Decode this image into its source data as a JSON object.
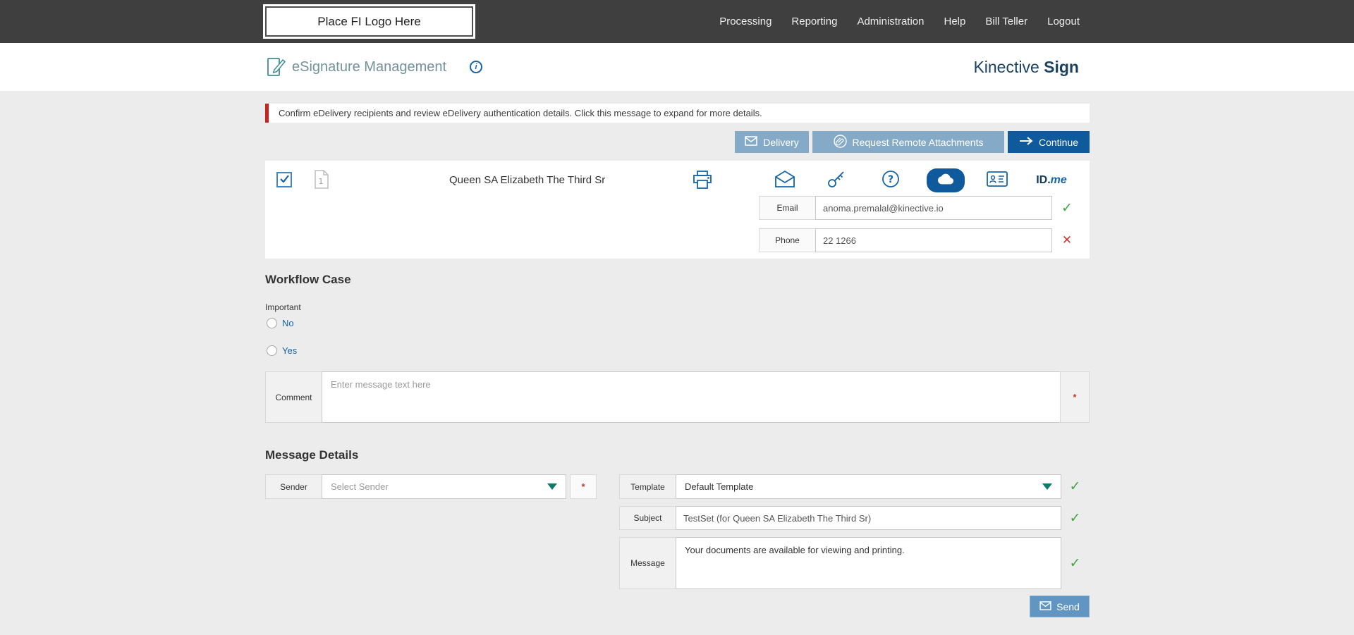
{
  "colors": {
    "accent_blue": "#1565a8",
    "dark_blue": "#0e5a9c",
    "steel_blue": "#84aac8",
    "send_blue": "#6096c1",
    "navy_brand": "#1b4263",
    "teal_caret": "#0b7c6c",
    "success_green": "#41a443",
    "error_red": "#c63232",
    "alert_red": "#c7231f",
    "topbar_gray": "#3f3f3f",
    "page_gray": "#ececec"
  },
  "icons": {
    "check_glyph": "✓",
    "cross_glyph": "✕",
    "required_glyph": "*",
    "info_glyph": "i"
  },
  "topbar": {
    "logo_placeholder": "Place FI Logo Here",
    "nav": [
      {
        "label": "Processing"
      },
      {
        "label": "Reporting"
      },
      {
        "label": "Administration"
      },
      {
        "label": "Help"
      },
      {
        "label": "Bill Teller"
      },
      {
        "label": "Logout"
      }
    ]
  },
  "header": {
    "title": "eSignature Management",
    "brand_name": "Kinective ",
    "brand_product": "Sign"
  },
  "alert": {
    "message": "Confirm eDelivery recipients and review eDelivery authentication details. Click this message to expand for more details."
  },
  "actions": {
    "delivery_label": "Delivery",
    "request_remote_attachments_label": "Request Remote Attachments",
    "continue_label": "Continue"
  },
  "recipient": {
    "name": "Queen SA Elizabeth The Third Sr",
    "document_badge": "1",
    "idme": {
      "id_part": "ID.",
      "me_part": "me"
    },
    "email": {
      "label": "Email",
      "value": "anoma.premalal@kinective.io"
    },
    "phone": {
      "label": "Phone",
      "value": "22 1266"
    }
  },
  "workflow_case": {
    "heading": "Workflow Case",
    "field_label": "Important",
    "options": [
      {
        "label": "No"
      },
      {
        "label": "Yes"
      }
    ],
    "comment": {
      "label": "Comment",
      "placeholder": "Enter message text here"
    }
  },
  "message_details": {
    "heading": "Message Details",
    "sender": {
      "label": "Sender",
      "placeholder": "Select Sender"
    },
    "template": {
      "label": "Template",
      "value": "Default Template"
    },
    "subject": {
      "label": "Subject",
      "value": "TestSet (for Queen SA Elizabeth The Third Sr)"
    },
    "message": {
      "label": "Message",
      "value": "Your documents are available for viewing and printing."
    },
    "send_label": "Send"
  }
}
